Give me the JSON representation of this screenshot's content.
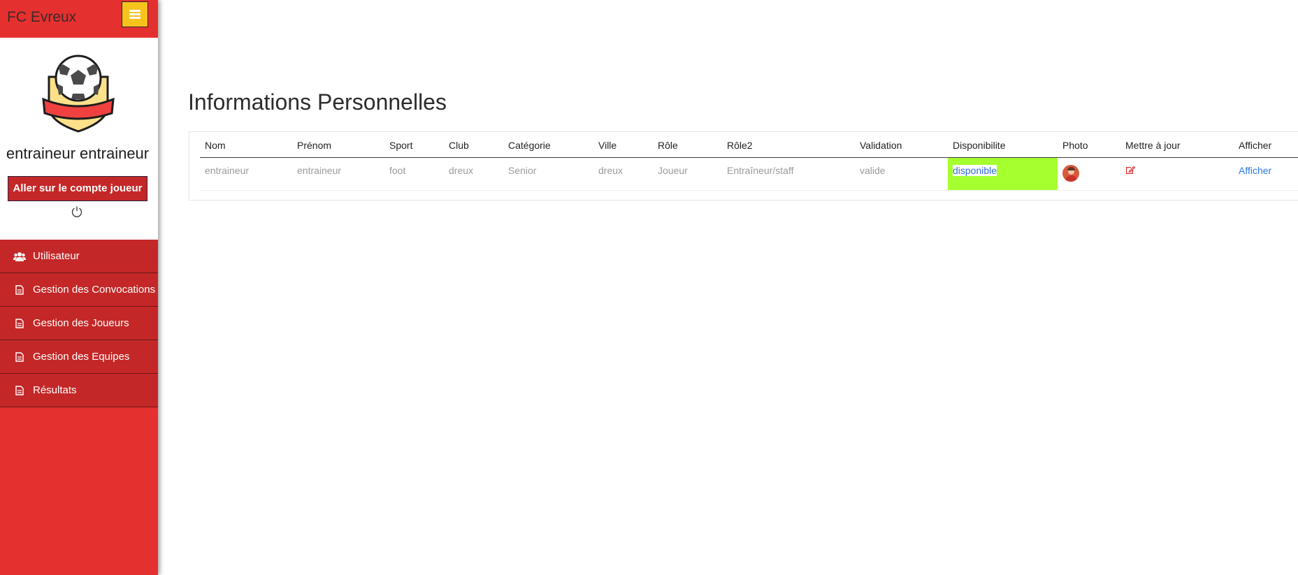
{
  "app": {
    "brand": "FC Evreux"
  },
  "colors": {
    "sidebar": "#e53030",
    "nav_item": "#c42727",
    "menu_button": "#f6c21c",
    "availability_highlight": "#a6ff2e",
    "link": "#2a7ae0"
  },
  "profile": {
    "name": "entraineur entraineur",
    "account_button": "Aller sur le compte joueur"
  },
  "nav": {
    "items": [
      {
        "label": "Utilisateur",
        "icon": "users-icon"
      },
      {
        "label": "Gestion des Convocations",
        "icon": "document-icon"
      },
      {
        "label": "Gestion des Joueurs",
        "icon": "document-icon"
      },
      {
        "label": "Gestion des Equipes",
        "icon": "document-icon"
      },
      {
        "label": "Résultats",
        "icon": "document-icon"
      }
    ]
  },
  "main": {
    "title": "Informations Personnelles",
    "table": {
      "headers": [
        "Nom",
        "Prénom",
        "Sport",
        "Club",
        "Catégorie",
        "Ville",
        "Rôle",
        "Rôle2",
        "Validation",
        "Disponibilite",
        "Photo",
        "Mettre à jour",
        "Afficher"
      ],
      "rows": [
        {
          "nom": "entraineur",
          "prenom": "entraineur",
          "sport": "foot",
          "club": "dreux",
          "categorie": "Senior",
          "ville": "dreux",
          "role": "Joueur",
          "role2": "Entraîneur/staff",
          "validation": "valide",
          "disponibilite": "disponible",
          "photo_icon": "avatar-icon",
          "update_icon": "edit-icon",
          "afficher": "Afficher"
        }
      ]
    }
  }
}
